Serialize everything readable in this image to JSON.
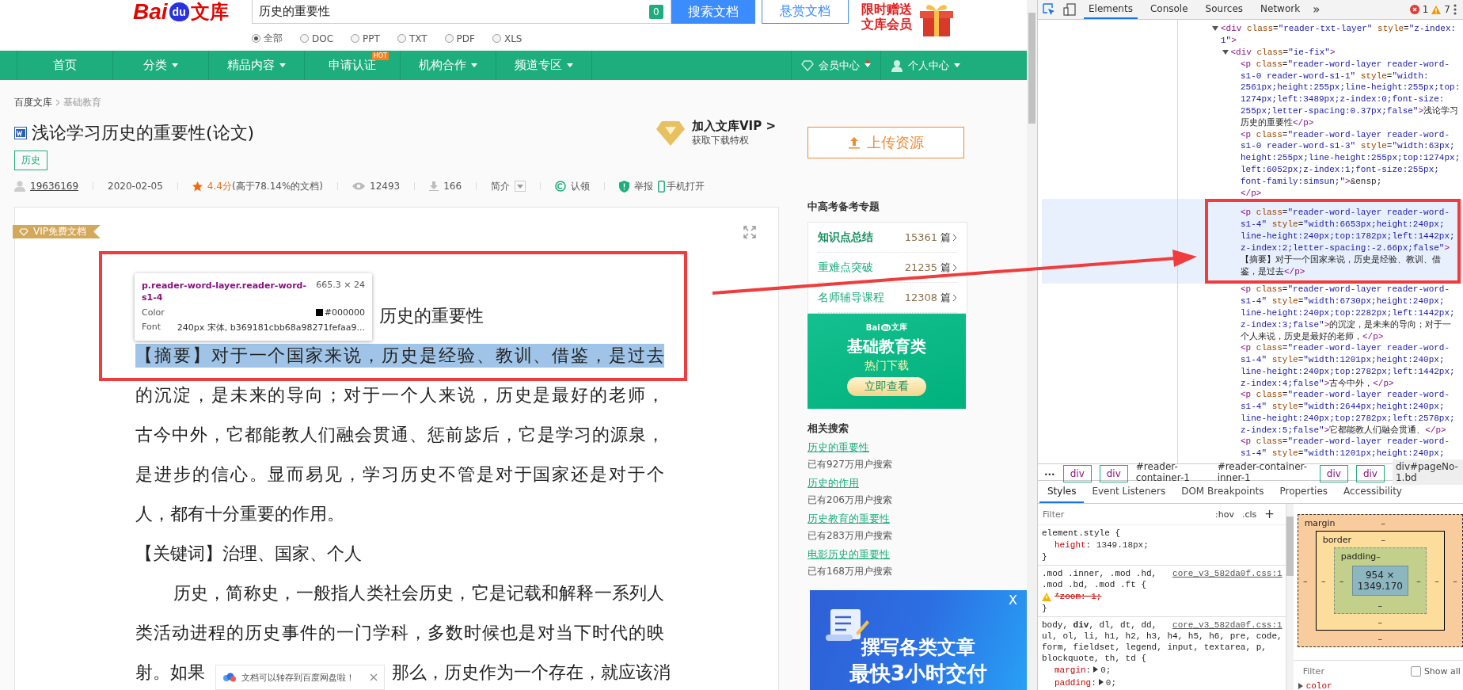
{
  "header": {
    "logo": {
      "brand": "Bai",
      "paw": "du",
      "product": "文库"
    },
    "search": {
      "value": "历史的重要性",
      "count": "0"
    },
    "buttons": [
      "搜索文档",
      "悬赏文档"
    ],
    "promo": [
      "限时赠送",
      "文库会员"
    ],
    "filters": [
      {
        "label": "全部",
        "selected": true
      },
      {
        "label": "DOC",
        "selected": false
      },
      {
        "label": "PPT",
        "selected": false
      },
      {
        "label": "TXT",
        "selected": false
      },
      {
        "label": "PDF",
        "selected": false
      },
      {
        "label": "XLS",
        "selected": false
      }
    ]
  },
  "nav": {
    "items": [
      {
        "label": "首页",
        "dropdown": false
      },
      {
        "label": "分类",
        "dropdown": true
      },
      {
        "label": "精品内容",
        "dropdown": true
      },
      {
        "label": "申请认证",
        "dropdown": false,
        "badge": "HOT"
      },
      {
        "label": "机构合作",
        "dropdown": true
      },
      {
        "label": "频道专区",
        "dropdown": true
      }
    ],
    "right": [
      {
        "kind": "vip",
        "label": "会员中心",
        "notify": true
      },
      {
        "kind": "user",
        "label": "个人中心",
        "notify": false
      }
    ]
  },
  "breadcrumb": [
    "百度文库",
    "基础教育"
  ],
  "doc": {
    "title": "浅论学习历史的重要性(论文)",
    "tags": [
      "历史"
    ],
    "meta": {
      "author": "19636169",
      "date": "2020-02-05",
      "score": "4.4分",
      "rank": "(高于78.14%的文档)",
      "views": "12493",
      "downloads": "166",
      "summary": "简介",
      "claim": "认领",
      "report": "举报",
      "mobile": "手机打开"
    },
    "vip": {
      "title": "加入文库VIP >",
      "subtitle": "获取下载特权"
    },
    "ribbon": "VIP免费文档",
    "lines": [
      {
        "kind": "title",
        "parts": [
          "历史的重要性"
        ],
        "highlighted": false
      },
      {
        "kind": "full",
        "parts": [
          "【摘要】对于一个国家来说，历史是经验、教训、借鉴，是过去"
        ],
        "highlighted": true
      },
      {
        "kind": "full",
        "parts": [
          "的沉淀，是未来的导向；对于一个人来说，历史是最好的老师，"
        ],
        "highlighted": false
      },
      {
        "kind": "full",
        "parts": [
          "古今中外，它都能教人们融会贯通、惩前毖后，它是学习的源泉，"
        ],
        "highlighted": false
      },
      {
        "kind": "full",
        "parts": [
          "是进步的信心。显而易见，学习历史不管是对于国家还是对于个"
        ],
        "highlighted": false
      },
      {
        "kind": "last",
        "parts": [
          "人，都有十分重要的作用。"
        ],
        "highlighted": false
      },
      {
        "kind": "last",
        "parts": [
          "【关键词】治理、国家、个人"
        ],
        "highlighted": false
      },
      {
        "kind": "indent",
        "parts": [
          "历史，简称史，一般指人类社会历史，它是记载和解释一系列人"
        ],
        "highlighted": false
      },
      {
        "kind": "full",
        "parts": [
          "类活动进程的历史事件的一门学科，多数时候也是对当下时代的映"
        ],
        "highlighted": false
      },
      {
        "kind": "split",
        "parts": [
          "射。如果",
          "那么，历史作为一个存在，就应该消"
        ],
        "highlighted": false
      }
    ]
  },
  "upload": "上传资源",
  "sidebar": {
    "topic_title": "中高考备考专题",
    "topics": [
      {
        "label": "知识点总结",
        "count": "15361",
        "unit": "篇",
        "selected": true
      },
      {
        "label": "重难点突破",
        "count": "21235",
        "unit": "篇",
        "selected": false
      },
      {
        "label": "名师辅导课程",
        "count": "12308",
        "unit": "篇",
        "selected": false
      }
    ],
    "banner": {
      "brand": "Bai",
      "paw": "du",
      "product": "文库",
      "title": "基础教育类",
      "subtitle": "热门下载",
      "button": "立即查看"
    },
    "related_title": "相关搜索",
    "related": [
      {
        "query": "历史的重要性",
        "count": "已有927万用户搜索"
      },
      {
        "query": "历史的作用",
        "count": "已有206万用户搜索"
      },
      {
        "query": "历史教育的重要性",
        "count": "已有283万用户搜索"
      },
      {
        "query": "电影历史的重要性",
        "count": "已有168万用户搜索"
      }
    ]
  },
  "tooltip": {
    "selector": "p.reader-word-layer.reader-word-s1-4",
    "size": "665.3 × 24",
    "rows": [
      {
        "kind": "color",
        "label": "Color",
        "value": "#000000"
      },
      {
        "kind": "text",
        "label": "Font",
        "value": "240px 宋体, b369181cbb68a98271fefaa9..."
      }
    ]
  },
  "toast": {
    "text": "文档可以转存到百度网盘啦！"
  },
  "ad": {
    "close": "X",
    "lines": [
      "撰写各类文章",
      "最快3小时交付"
    ]
  },
  "devtools": {
    "tabs": [
      {
        "label": "Elements",
        "selected": true
      },
      {
        "label": "Console",
        "selected": false
      },
      {
        "label": "Sources",
        "selected": false
      },
      {
        "label": "Network",
        "selected": false
      }
    ],
    "more": "»",
    "errors": "1",
    "warnings": "7",
    "tree": [
      {
        "expanded": true,
        "selected": false,
        "lines": [
          "<div class=\"reader-txt-layer\" style=\"z-index:",
          "1\">"
        ],
        "children": [
          {
            "expanded": true,
            "selected": false,
            "lines": [
              "<div class=\"ie-fix\">"
            ],
            "children": [
              {
                "selected": false,
                "lines": [
                  "<p class=\"reader-word-layer reader-word-",
                  "s1-0 reader-word-s1-1\" style=\"width:",
                  "2561px;height:255px;line-height:255px;top:",
                  "1274px;left:3489px;z-index:0;font-size:",
                  "255px;letter-spacing:0.37px;false\">浅论学习",
                  "历史的重要性</p>"
                ]
              },
              {
                "selected": false,
                "lines": [
                  "<p class=\"reader-word-layer reader-word-",
                  "s1-0 reader-word-s1-3\" style=\"width:63px;",
                  "height:255px;line-height:255px;top:1274px;",
                  "left:6052px;z-index:1;font-size:255px;",
                  "font-family:simsun;\">&ensp;",
                  "</p>"
                ]
              },
              {
                "selected": true,
                "lines": [
                  "<p class=\"reader-word-layer reader-word-",
                  "s1-4\" style=\"width:6653px;height:240px;",
                  "line-height:240px;top:1782px;left:1442px;",
                  "z-index:2;letter-spacing:-2.66px;false\">",
                  "【摘要】对于一个国家来说，历史是经验、教训、借",
                  "鉴，是过去</p>"
                ]
              },
              {
                "selected": false,
                "lines": [
                  "<p class=\"reader-word-layer reader-word-",
                  "s1-4\" style=\"width:6730px;height:240px;",
                  "line-height:240px;top:2282px;left:1442px;",
                  "z-index:3;false\">的沉淀，是未来的导向；对于一",
                  "个人来说，历史是最好的老师，</p>"
                ]
              },
              {
                "selected": false,
                "lines": [
                  "<p class=\"reader-word-layer reader-word-",
                  "s1-4\" style=\"width:1201px;height:240px;",
                  "line-height:240px;top:2782px;left:1442px;",
                  "z-index:4;false\">古今中外，</p>"
                ]
              },
              {
                "selected": false,
                "lines": [
                  "<p class=\"reader-word-layer reader-word-",
                  "s1-4\" style=\"width:2644px;height:240px;",
                  "line-height:240px;top:2782px;left:2578px;",
                  "z-index:5;false\">它都能教人们融会贯通、</p>"
                ]
              },
              {
                "selected": false,
                "lines": [
                  "<p class=\"reader-word-layer reader-word-",
                  "s1-4\" style=\"width:1201px;height:240px;"
                ]
              }
            ]
          }
        ]
      }
    ],
    "breadcrumbs": [
      {
        "kind": "more",
        "label": "...",
        "selected": false
      },
      {
        "kind": "tag",
        "label": "div",
        "selected": false
      },
      {
        "kind": "tag",
        "label": "div",
        "selected": false
      },
      {
        "kind": "id",
        "label": "#reader-container-1",
        "selected": false
      },
      {
        "kind": "id",
        "label": "#reader-container-inner-1",
        "selected": false
      },
      {
        "kind": "tag",
        "label": "div",
        "selected": false
      },
      {
        "kind": "tag",
        "label": "div",
        "selected": false
      },
      {
        "kind": "id",
        "label": "div#pageNo-1.bd",
        "selected": true
      }
    ],
    "subtabs": [
      {
        "label": "Styles",
        "selected": true
      },
      {
        "label": "Event Listeners",
        "selected": false
      },
      {
        "label": "DOM Breakpoints",
        "selected": false
      },
      {
        "label": "Properties",
        "selected": false
      },
      {
        "label": "Accessibility",
        "selected": false
      }
    ],
    "styles": {
      "placeholder": "Filter",
      "hov": ":hov",
      "cls": ".cls",
      "add": "+",
      "rules": [
        {
          "selector": [
            "element.style {"
          ],
          "decls": [
            {
              "prop": "height",
              "value": ": 1349.18px;",
              "overridden": false,
              "expandable": false
            }
          ],
          "close": "}"
        },
        {
          "selector": [
            ".mod .inner, .mod .hd,",
            ".mod .bd, .mod .ft {"
          ],
          "source": "core_v3_582da0f.css:1",
          "decls": [
            {
              "prop": "*zoom",
              "value": ": 1;",
              "overridden": true,
              "expandable": false
            }
          ],
          "close": "}"
        },
        {
          "selector": [
            "body, **div**, dl, dt, dd,",
            "ul, ol, li, h1, h2, h3, h4, h5, h6, pre, code,",
            "form, fieldset, legend, input, textarea, p,",
            "blockquote, th, td {"
          ],
          "source": "core_v3_582da0f.css:1",
          "decls": [
            {
              "prop": "margin",
              "value": ":",
              "tail": "0;",
              "overridden": false,
              "expandable": true
            },
            {
              "prop": "padding",
              "value": ":",
              "tail": "0;",
              "overridden": false,
              "expandable": true
            }
          ]
        }
      ]
    },
    "box_model": {
      "label": "margin",
      "top": "–",
      "left": "–",
      "inner": {
        "label": "border",
        "top": "–",
        "left": "–",
        "inner": {
          "label": "padding",
          "top": "–",
          "left": "–",
          "content": "954 × 1349.170",
          "right": "–",
          "bottom": "–"
        },
        "right": "–",
        "bottom": "–"
      },
      "right": "–",
      "bottom": "–"
    },
    "computed": {
      "placeholder": "Filter",
      "show_all": {
        "label": "Show all",
        "checked": false
      },
      "properties": [
        "color"
      ]
    }
  }
}
